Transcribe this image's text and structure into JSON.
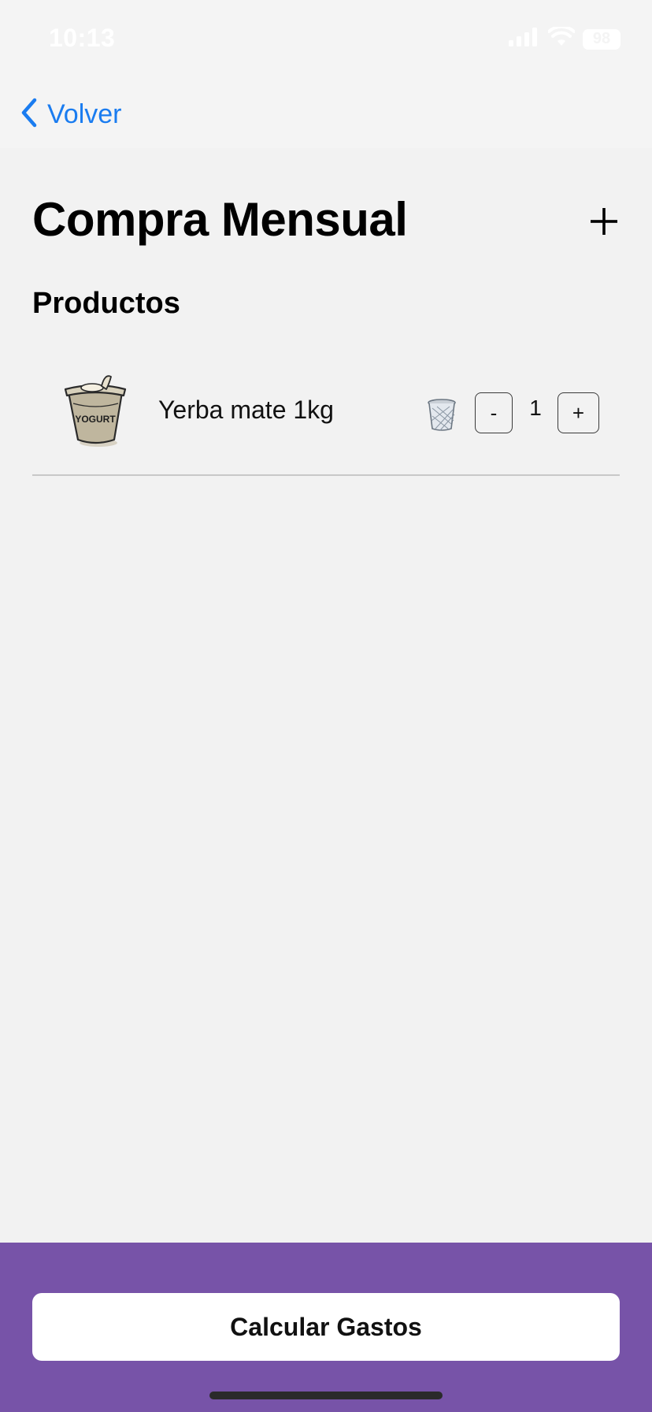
{
  "status_bar": {
    "time": "10:13",
    "battery": "98",
    "icons": [
      "signal-icon",
      "wifi-icon",
      "battery-icon"
    ]
  },
  "nav": {
    "back_label": "Volver",
    "back_icon": "chevron-left-icon",
    "accent_color": "#1a7cf0"
  },
  "header": {
    "title": "Compra Mensual",
    "add_icon": "plus-icon"
  },
  "section": {
    "title": "Productos"
  },
  "products": [
    {
      "name": "Yerba mate 1kg",
      "image_icon": "yogurt-icon",
      "image_label": "YOGURT",
      "delete_icon": "trash-icon",
      "decrement_label": "-",
      "quantity": "1",
      "increment_label": "+"
    }
  ],
  "footer": {
    "button_label": "Calcular Gastos",
    "background_color": "#7753a8"
  }
}
